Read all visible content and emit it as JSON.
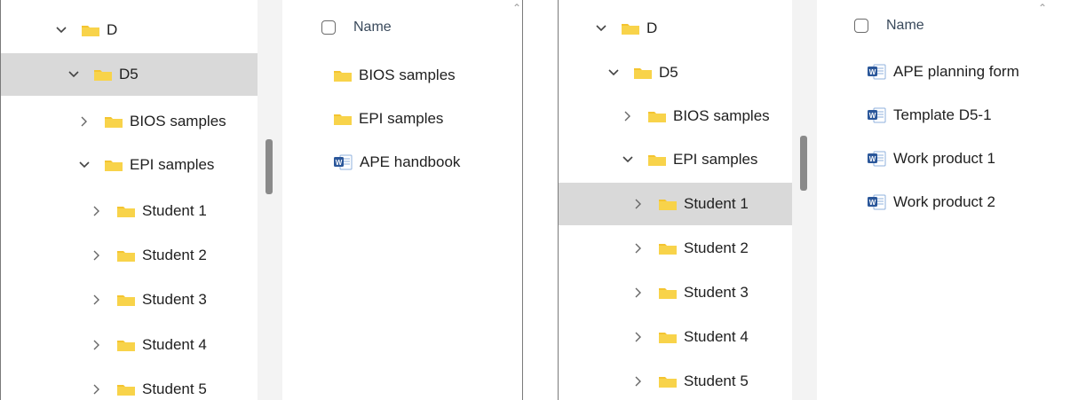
{
  "colors": {
    "folder": "#f4c430",
    "selection": "#d9d9d9",
    "word_blue": "#2b579a",
    "header_text": "#3a4a5c"
  },
  "left": {
    "nav": {
      "items": [
        {
          "label": "D",
          "chevron": "down"
        },
        {
          "label": "D5",
          "chevron": "down",
          "selected": true
        },
        {
          "label": "BIOS samples",
          "chevron": "right"
        },
        {
          "label": "EPI samples",
          "chevron": "down"
        },
        {
          "label": "Student 1",
          "chevron": "right"
        },
        {
          "label": "Student 2",
          "chevron": "right"
        },
        {
          "label": "Student 3",
          "chevron": "right"
        },
        {
          "label": "Student 4",
          "chevron": "right"
        },
        {
          "label": "Student 5",
          "chevron": "right"
        }
      ]
    },
    "content": {
      "header": "Name",
      "items": [
        {
          "label": "BIOS samples",
          "icon": "folder-icon"
        },
        {
          "label": "EPI samples",
          "icon": "folder-icon"
        },
        {
          "label": "APE handbook",
          "icon": "word-doc-icon"
        }
      ]
    }
  },
  "right": {
    "nav": {
      "items": [
        {
          "label": "D",
          "chevron": "down"
        },
        {
          "label": "D5",
          "chevron": "down"
        },
        {
          "label": "BIOS samples",
          "chevron": "right"
        },
        {
          "label": "EPI samples",
          "chevron": "down"
        },
        {
          "label": "Student 1",
          "chevron": "right",
          "selected": true
        },
        {
          "label": "Student 2",
          "chevron": "right"
        },
        {
          "label": "Student 3",
          "chevron": "right"
        },
        {
          "label": "Student 4",
          "chevron": "right"
        },
        {
          "label": "Student 5",
          "chevron": "right"
        }
      ]
    },
    "content": {
      "header": "Name",
      "items": [
        {
          "label": "APE planning form",
          "icon": "word-doc-icon"
        },
        {
          "label": "Template D5-1",
          "icon": "word-doc-icon"
        },
        {
          "label": "Work product 1",
          "icon": "word-doc-icon"
        },
        {
          "label": "Work product 2",
          "icon": "word-doc-icon"
        }
      ]
    }
  }
}
